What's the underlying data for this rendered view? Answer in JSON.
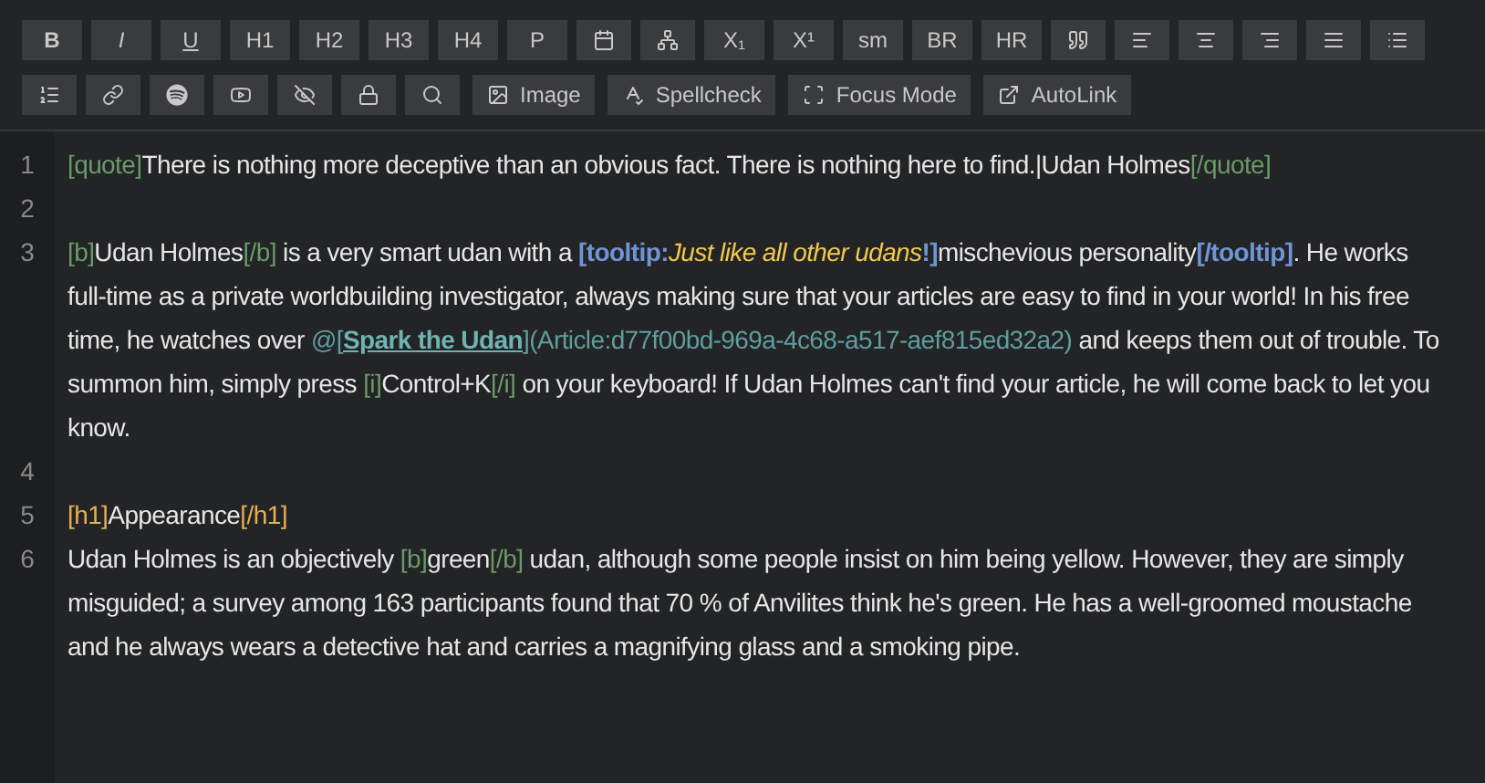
{
  "toolbar": {
    "groups": [
      {
        "buttons": [
          {
            "kind": "bold",
            "label": "B"
          },
          {
            "kind": "italic",
            "label": "I"
          },
          {
            "kind": "underline",
            "label": "U"
          },
          {
            "kind": "text",
            "label": "H1"
          },
          {
            "kind": "text",
            "label": "H2"
          },
          {
            "kind": "text",
            "label": "H3"
          },
          {
            "kind": "text",
            "label": "H4"
          },
          {
            "kind": "text",
            "label": "P"
          },
          {
            "kind": "icon"
          },
          {
            "kind": "icon"
          },
          {
            "kind": "text",
            "label": "X₁"
          },
          {
            "kind": "text",
            "label": "X¹"
          },
          {
            "kind": "text",
            "label": "sm"
          },
          {
            "kind": "text",
            "label": "BR"
          },
          {
            "kind": "text",
            "label": "HR"
          },
          {
            "kind": "icon"
          },
          {
            "kind": "icon"
          },
          {
            "kind": "icon"
          },
          {
            "kind": "icon"
          },
          {
            "kind": "icon"
          },
          {
            "kind": "icon"
          }
        ]
      },
      {
        "buttons": [
          {
            "kind": "icon"
          },
          {
            "kind": "icon"
          },
          {
            "kind": "icon"
          },
          {
            "kind": "icon"
          },
          {
            "kind": "icon"
          },
          {
            "kind": "icon"
          },
          {
            "kind": "icon"
          },
          {
            "kind": "icon",
            "label": "Image"
          },
          {
            "kind": "icon",
            "label": "Spellcheck"
          },
          {
            "kind": "icon",
            "label": "Focus Mode"
          },
          {
            "kind": "icon",
            "label": "AutoLink"
          }
        ]
      }
    ]
  },
  "editor": {
    "lines": [
      {
        "number": "1",
        "segments": [
          {
            "kind": "tag",
            "text": "[quote]"
          },
          {
            "kind": "text",
            "text": "There is nothing more deceptive than an obvious fact. There is nothing here to find.|Udan Holmes"
          },
          {
            "kind": "tag",
            "text": "[/quote]"
          }
        ]
      },
      {
        "number": "2"
      },
      {
        "number": "3",
        "segments": [
          {
            "kind": "tag",
            "text": "[b]"
          },
          {
            "kind": "text",
            "text": "Udan Holmes"
          },
          {
            "kind": "tag",
            "text": "[/b]"
          },
          {
            "kind": "text",
            "text": " is a very smart udan with a "
          },
          {
            "kind": "tooltip_tag",
            "text": "[tooltip:"
          },
          {
            "kind": "tooltip_text",
            "text": "Just like all other udans"
          },
          {
            "kind": "tooltip_tag",
            "text": "!]"
          },
          {
            "kind": "text",
            "text": "mischevious personality"
          },
          {
            "kind": "tooltip_tag",
            "text": "[/tooltip]"
          },
          {
            "kind": "text",
            "text": ". He works full-time as a private worldbuilding investigator, always making sure that your articles are easy to find in your world! In his free time, he watches over "
          },
          {
            "kind": "mention",
            "text": "@["
          },
          {
            "kind": "mention_name",
            "text": "Spark the Udan"
          },
          {
            "kind": "mention",
            "text": "](Article:d77f00bd-969a-4c68-a517-aef815ed32a2)"
          },
          {
            "kind": "text",
            "text": " and keeps them out of trouble. To summon him, simply press "
          },
          {
            "kind": "tag",
            "text": "[i]"
          },
          {
            "kind": "text",
            "text": "Control+K"
          },
          {
            "kind": "tag",
            "text": "[/i]"
          },
          {
            "kind": "text",
            "text": " on your keyboard! If Udan Holmes can't find your article, he will come back to let you know."
          }
        ]
      },
      {
        "number": "4"
      },
      {
        "number": "5",
        "segments": [
          {
            "kind": "heading_tag",
            "text": "[h1]"
          },
          {
            "kind": "text",
            "text": "Appearance"
          },
          {
            "kind": "heading_tag",
            "text": "[/h1]"
          }
        ]
      },
      {
        "number": "6",
        "segments": [
          {
            "kind": "text",
            "text": "Udan Holmes is an objectively "
          },
          {
            "kind": "tag",
            "text": "[b]"
          },
          {
            "kind": "text",
            "text": "green"
          },
          {
            "kind": "tag",
            "text": "[/b]"
          },
          {
            "kind": "text",
            "text": " udan, although some people insist on him being yellow. However, they are simply misguided; a survey among 163 participants found that 70 % of Anvilites think he's green. He has a well-groomed moustache and he always wears a detective hat and carries a magnifying glass and a smoking pipe."
          }
        ]
      }
    ]
  }
}
